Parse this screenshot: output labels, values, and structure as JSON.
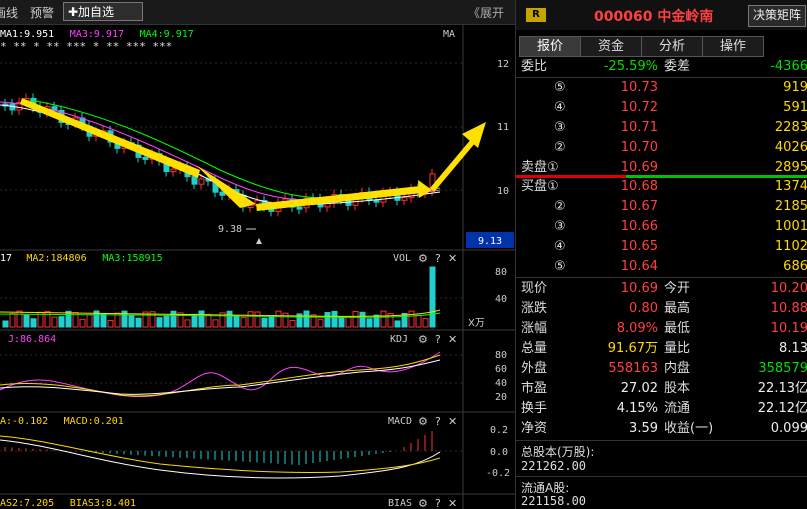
{
  "toolbar": {
    "item1": "画线",
    "item2": "预警",
    "add_watch": "✚加自选",
    "expand": "《展开"
  },
  "chart": {
    "ma_legend": [
      {
        "text": "MA1:9.951",
        "color": "#ffffff"
      },
      {
        "text": "MA3:9.917",
        "color": "#ff40ff"
      },
      {
        "text": "MA4:9.917",
        "color": "#00ff00"
      }
    ],
    "ma_label": "MA",
    "stars": "*    ** *   **    *** * ** ***   ***",
    "price_axis": [
      "12",
      "11",
      "10"
    ],
    "low_label": "9.38",
    "current_price_tag": "9.13",
    "vol": {
      "legend": [
        {
          "text": "17",
          "color": "#ffffff"
        },
        {
          "text": "MA2:184806",
          "color": "#ffd800"
        },
        {
          "text": "MA3:158915",
          "color": "#00ff00"
        }
      ],
      "name": "VOL",
      "axis": [
        "80",
        "40"
      ],
      "unit": "X万"
    },
    "kdj": {
      "legend": [
        {
          "text": "J:86.864",
          "color": "#ff40ff"
        }
      ],
      "name": "KDJ",
      "axis": [
        "80",
        "60",
        "40",
        "20"
      ]
    },
    "macd": {
      "legend": [
        {
          "text": "A:-0.102",
          "color": "#ffd800"
        },
        {
          "text": "MACD:0.201",
          "color": "#ffd800"
        }
      ],
      "name": "MACD",
      "axis": [
        "0.2",
        "0.0",
        "-0.2"
      ]
    },
    "bias": {
      "legend": [
        {
          "text": "AS2:7.205",
          "color": "#ffd800"
        },
        {
          "text": "BIAS3:8.401",
          "color": "#ffd800"
        }
      ],
      "name": "BIAS"
    },
    "panel_icons": {
      "gear": "⚙",
      "help": "?",
      "close": "✕"
    }
  },
  "quote": {
    "badge": "R",
    "code_name": "000060 中金岭南",
    "matrix_btn": "决策矩阵",
    "tabs": [
      "报价",
      "资金",
      "分析",
      "操作"
    ],
    "weibi_label": "委比",
    "weibi_value": "-25.59%",
    "weicha_label": "委差",
    "weicha_value": "-4366",
    "sell": [
      {
        "label": "⑤",
        "price": "10.73",
        "vol": "919"
      },
      {
        "label": "④",
        "price": "10.72",
        "vol": "591"
      },
      {
        "label": "③",
        "price": "10.71",
        "vol": "2283"
      },
      {
        "label": "②",
        "price": "10.70",
        "vol": "4026"
      },
      {
        "label": "卖盘①",
        "price": "10.69",
        "vol": "2895"
      }
    ],
    "buy": [
      {
        "label": "买盘①",
        "price": "10.68",
        "vol": "1374"
      },
      {
        "label": "②",
        "price": "10.67",
        "vol": "2185"
      },
      {
        "label": "③",
        "price": "10.66",
        "vol": "1001"
      },
      {
        "label": "④",
        "price": "10.65",
        "vol": "1102"
      },
      {
        "label": "⑤",
        "price": "10.64",
        "vol": "686"
      }
    ],
    "stats": [
      {
        "l1": "现价",
        "v1": "10.69",
        "c1": "red",
        "l2": "今开",
        "v2": "10.20",
        "c2": "red"
      },
      {
        "l1": "涨跌",
        "v1": "0.80",
        "c1": "red",
        "l2": "最高",
        "v2": "10.88",
        "c2": "red"
      },
      {
        "l1": "涨幅",
        "v1": "8.09%",
        "c1": "red",
        "l2": "最低",
        "v2": "10.19",
        "c2": "red"
      },
      {
        "l1": "总量",
        "v1": "91.67万",
        "c1": "yel",
        "l2": "量比",
        "v2": "8.13",
        "c2": "wht"
      },
      {
        "l1": "外盘",
        "v1": "558163",
        "c1": "red",
        "l2": "内盘",
        "v2": "358579",
        "c2": "grn"
      },
      {
        "l1": "市盈",
        "v1": "27.02",
        "c1": "wht",
        "l2": "股本",
        "v2": "22.13亿",
        "c2": "wht"
      },
      {
        "l1": "换手",
        "v1": "4.15%",
        "c1": "wht",
        "l2": "流通",
        "v2": "22.12亿",
        "c2": "wht"
      },
      {
        "l1": "净资",
        "v1": "3.59",
        "c1": "wht",
        "l2": "收益(一)",
        "v2": "0.099",
        "c2": "wht"
      }
    ],
    "total_shares_label": "总股本(万股):",
    "total_shares_value": "221262.00",
    "float_shares_label": "流通A股:",
    "float_shares_value": "221158.00"
  }
}
